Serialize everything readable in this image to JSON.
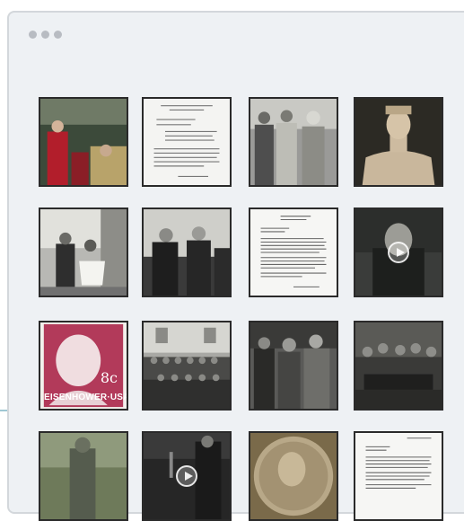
{
  "gallery": {
    "title": "",
    "stamp": {
      "value": "8c",
      "label": "EISENHOWER·USA"
    },
    "tiles": [
      {
        "subject": "man in academic gown speaking",
        "type": "photo"
      },
      {
        "subject": "typed document",
        "type": "document"
      },
      {
        "subject": "officers standing outdoors",
        "type": "photo"
      },
      {
        "subject": "bronze bust",
        "type": "photo"
      },
      {
        "subject": "couple seated on porch",
        "type": "photo"
      },
      {
        "subject": "men greeting crowd",
        "type": "photo"
      },
      {
        "subject": "typed letter",
        "type": "document"
      },
      {
        "subject": "televised address",
        "type": "video"
      },
      {
        "subject": "postage stamp",
        "type": "stamp"
      },
      {
        "subject": "group portrait of officers",
        "type": "photo"
      },
      {
        "subject": "officers in greatcoats",
        "type": "photo"
      },
      {
        "subject": "signing at a table",
        "type": "photo"
      },
      {
        "subject": "standing statue",
        "type": "photo"
      },
      {
        "subject": "speech at microphones",
        "type": "video"
      },
      {
        "subject": "dollar coin",
        "type": "photo"
      },
      {
        "subject": "typed letter",
        "type": "document"
      }
    ]
  },
  "colors": {
    "window_bg": "#eef1f4",
    "window_border": "#d3d7db",
    "dot": "#b8bcc2",
    "stamp": "#b23a5a"
  }
}
